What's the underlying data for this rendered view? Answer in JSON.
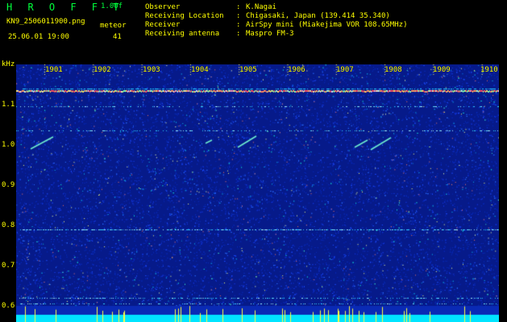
{
  "header": {
    "app_title": "H R O F F T",
    "version": "1.00f",
    "filename": "KN9_2506011900.png",
    "meteor_label": "meteor",
    "timestamp": "25.06.01 19:00",
    "meteor_count": "41"
  },
  "info": [
    {
      "key": "Observer",
      "value": "K.Nagai"
    },
    {
      "key": "Receiving Location",
      "value": "Chigasaki, Japan (139.414 35.340)"
    },
    {
      "key": "Receiver",
      "value": "AirSpy mini (Miakejima VOR 108.65MHz)"
    },
    {
      "key": "Receiving antenna",
      "value": "Maspro FM-3"
    }
  ],
  "y_axis": {
    "unit": "kHz",
    "ticks": [
      "1.1",
      "1.0",
      "0.9",
      "0.8",
      "0.7",
      "0.6"
    ]
  },
  "time_axis": {
    "labels": [
      "1901",
      "1902",
      "1903",
      "1904",
      "1905",
      "1906",
      "1907",
      "1908",
      "1909",
      "1910"
    ]
  },
  "colors": {
    "background": "#000000",
    "plot_background": "#061a8a",
    "label_yellow": "#ffff00",
    "title_green": "#00ff3c",
    "baseline_cyan": "#00e5ff"
  }
}
